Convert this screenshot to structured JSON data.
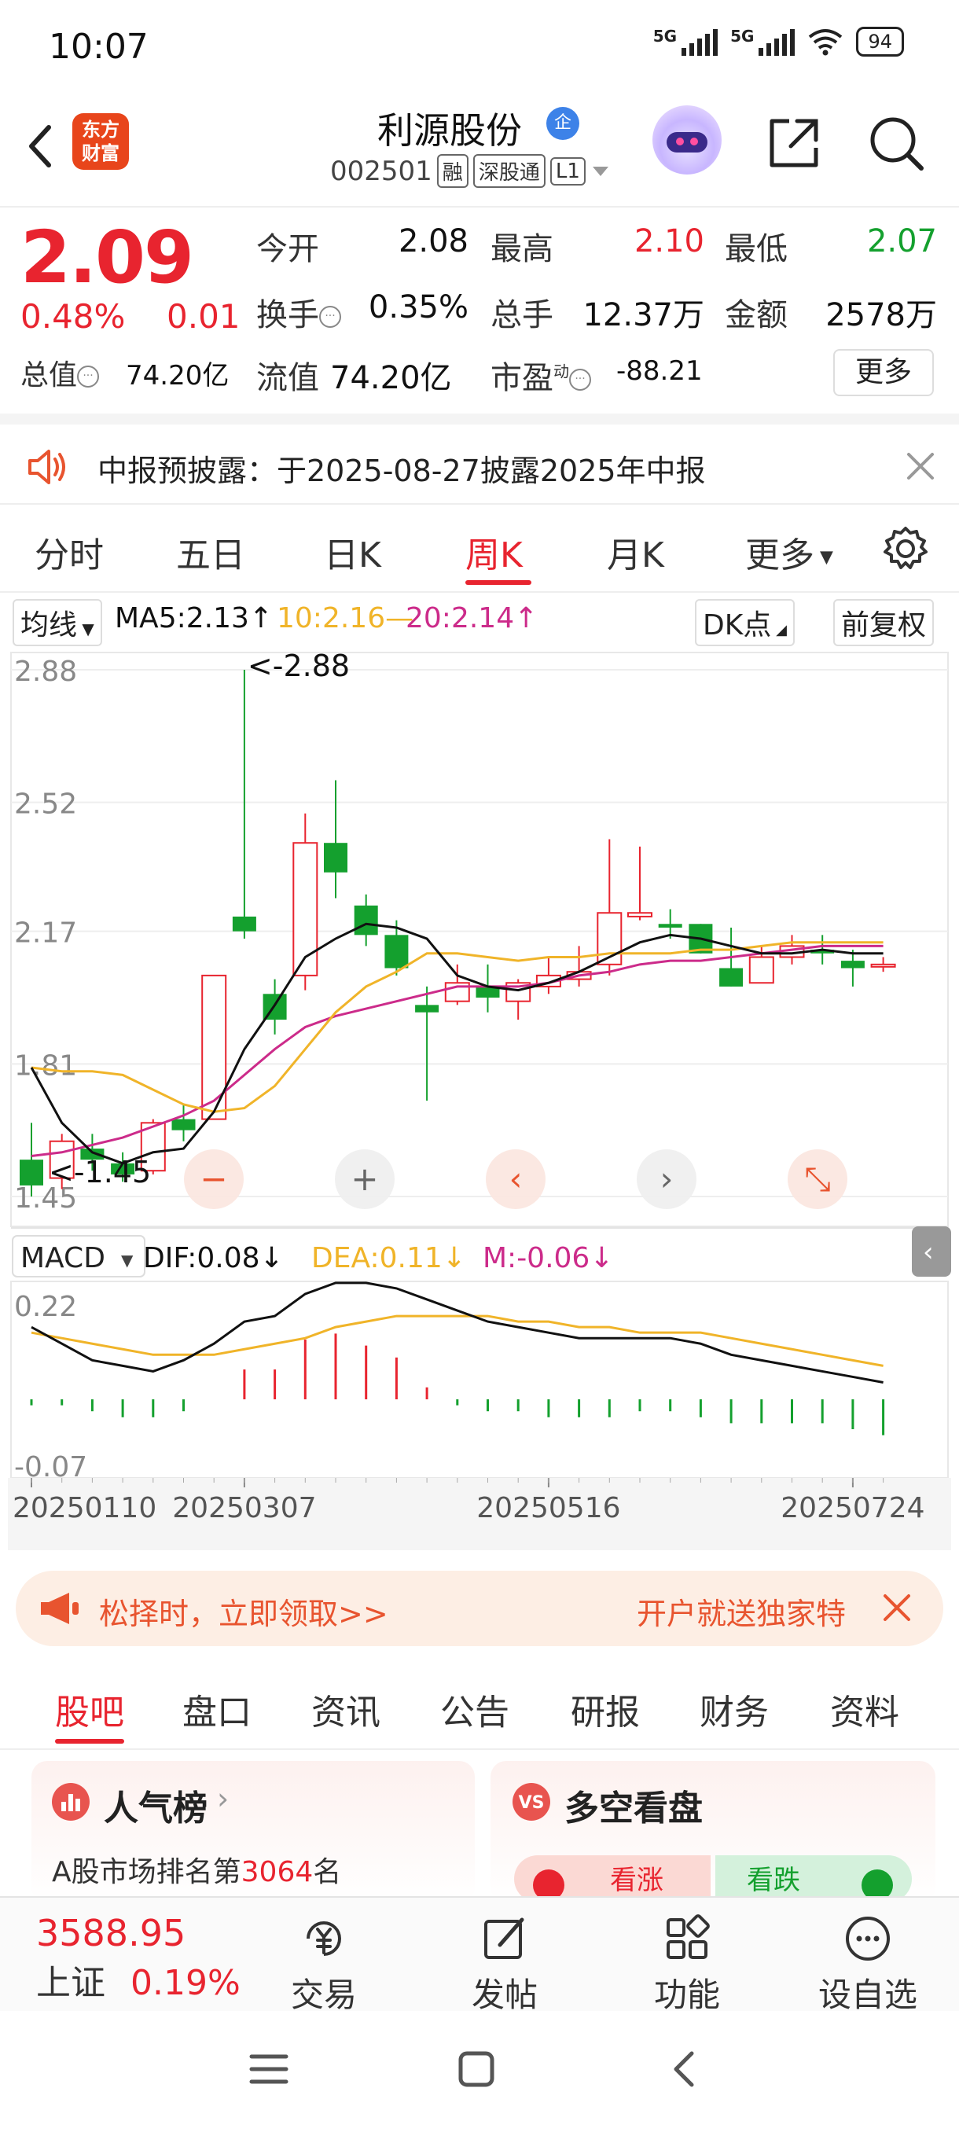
{
  "status_bar": {
    "time": "10:07",
    "network_1": "5G",
    "network_2": "5G",
    "battery": "94"
  },
  "header": {
    "logo_line1": "东方",
    "logo_line2": "财富",
    "stock_name": "利源股份",
    "badge": "企",
    "stock_code": "002501",
    "tags": [
      "融",
      "深股通",
      "L1"
    ]
  },
  "quote": {
    "price": "2.09",
    "change_pct": "0.48%",
    "change_amt": "0.01",
    "open_label": "今开",
    "open": "2.08",
    "high_label": "最高",
    "high": "2.10",
    "low_label": "最低",
    "low": "2.07",
    "turnover_label": "换手",
    "turnover": "0.35%",
    "volume_label": "总手",
    "volume": "12.37万",
    "amount_label": "金额",
    "amount": "2578万",
    "mktcap_label": "总值",
    "mktcap": "74.20亿",
    "float_label": "流值",
    "float": "74.20亿",
    "pe_label": "市盈",
    "pe_sup": "动",
    "pe": "-88.21",
    "more": "更多"
  },
  "notice": {
    "text": "中报预披露：于2025-08-27披露2025年中报"
  },
  "chart_tabs": [
    "分时",
    "五日",
    "日K",
    "周K",
    "月K",
    "更多"
  ],
  "chart_tabs_active": 3,
  "indicator": {
    "ma_select": "均线",
    "ma5": "MA5:2.13",
    "ma10": "10:2.16",
    "ma20": "20:2.14",
    "dk": "DK点",
    "adj": "前复权"
  },
  "macd": {
    "select": "MACD",
    "dif": "DIF:0.08",
    "dea": "DEA:0.11",
    "m": "M:-0.06"
  },
  "colors": {
    "up": "#e8242f",
    "down": "#14a02e",
    "ma5": "#111111",
    "ma10": "#f0b429",
    "ma20": "#cc2b8a"
  },
  "chart_data": {
    "type": "candlestick",
    "y_ticks": [
      "2.88",
      "2.52",
      "2.17",
      "1.81",
      "1.45"
    ],
    "ylim": [
      1.45,
      2.88
    ],
    "max_label": "<-2.88",
    "min_label": "<-1.45",
    "x_labels": [
      "20250110",
      "20250307",
      "20250516",
      "20250724"
    ],
    "candles": [
      {
        "o": 1.55,
        "c": 1.48,
        "h": 1.65,
        "l": 1.45
      },
      {
        "o": 1.5,
        "c": 1.6,
        "h": 1.62,
        "l": 1.47
      },
      {
        "o": 1.58,
        "c": 1.55,
        "h": 1.62,
        "l": 1.52
      },
      {
        "o": 1.54,
        "c": 1.51,
        "h": 1.57,
        "l": 1.49
      },
      {
        "o": 1.52,
        "c": 1.65,
        "h": 1.66,
        "l": 1.51
      },
      {
        "o": 1.66,
        "c": 1.63,
        "h": 1.7,
        "l": 1.6
      },
      {
        "o": 1.66,
        "c": 2.05,
        "h": 2.05,
        "l": 1.66
      },
      {
        "o": 2.21,
        "c": 2.17,
        "h": 2.88,
        "l": 2.15
      },
      {
        "o": 2.0,
        "c": 1.93,
        "h": 2.04,
        "l": 1.89
      },
      {
        "o": 2.05,
        "c": 2.41,
        "h": 2.49,
        "l": 2.01
      },
      {
        "o": 2.41,
        "c": 2.33,
        "h": 2.58,
        "l": 2.26
      },
      {
        "o": 2.24,
        "c": 2.16,
        "h": 2.27,
        "l": 2.13
      },
      {
        "o": 2.16,
        "c": 2.07,
        "h": 2.2,
        "l": 2.05
      },
      {
        "o": 1.97,
        "c": 1.95,
        "h": 2.02,
        "l": 1.71
      },
      {
        "o": 1.98,
        "c": 2.03,
        "h": 2.08,
        "l": 1.97
      },
      {
        "o": 2.02,
        "c": 1.99,
        "h": 2.08,
        "l": 1.95
      },
      {
        "o": 1.98,
        "c": 2.03,
        "h": 2.04,
        "l": 1.93
      },
      {
        "o": 2.02,
        "c": 2.05,
        "h": 2.1,
        "l": 2.0
      },
      {
        "o": 2.04,
        "c": 2.06,
        "h": 2.13,
        "l": 2.02
      },
      {
        "o": 2.08,
        "c": 2.22,
        "h": 2.42,
        "l": 2.05
      },
      {
        "o": 2.21,
        "c": 2.22,
        "h": 2.4,
        "l": 2.2
      },
      {
        "o": 2.19,
        "c": 2.18,
        "h": 2.23,
        "l": 2.15
      },
      {
        "o": 2.19,
        "c": 2.11,
        "h": 2.19,
        "l": 2.11
      },
      {
        "o": 2.07,
        "c": 2.02,
        "h": 2.18,
        "l": 2.02
      },
      {
        "o": 2.03,
        "c": 2.1,
        "h": 2.13,
        "l": 2.03
      },
      {
        "o": 2.1,
        "c": 2.13,
        "h": 2.16,
        "l": 2.08
      },
      {
        "o": 2.12,
        "c": 2.11,
        "h": 2.16,
        "l": 2.08
      },
      {
        "o": 2.09,
        "c": 2.07,
        "h": 2.12,
        "l": 2.02
      },
      {
        "o": 2.08,
        "c": 2.08,
        "h": 2.1,
        "l": 2.06
      }
    ],
    "ma5": [
      1.8,
      1.65,
      1.57,
      1.54,
      1.57,
      1.58,
      1.68,
      1.85,
      1.97,
      2.1,
      2.15,
      2.19,
      2.18,
      2.15,
      2.05,
      2.02,
      2.01,
      2.03,
      2.06,
      2.1,
      2.14,
      2.16,
      2.15,
      2.13,
      2.11,
      2.11,
      2.12,
      2.11,
      2.11
    ],
    "ma10": [
      1.8,
      1.79,
      1.79,
      1.78,
      1.74,
      1.7,
      1.68,
      1.69,
      1.75,
      1.85,
      1.95,
      2.02,
      2.06,
      2.11,
      2.11,
      2.1,
      2.09,
      2.1,
      2.1,
      2.11,
      2.11,
      2.11,
      2.12,
      2.12,
      2.13,
      2.14,
      2.14,
      2.14,
      2.14
    ],
    "ma20": [
      1.56,
      1.57,
      1.59,
      1.61,
      1.64,
      1.67,
      1.71,
      1.78,
      1.85,
      1.91,
      1.94,
      1.96,
      1.98,
      2.0,
      2.02,
      2.02,
      2.02,
      2.03,
      2.05,
      2.06,
      2.08,
      2.09,
      2.09,
      2.1,
      2.11,
      2.12,
      2.13,
      2.13,
      2.13
    ],
    "macd": {
      "y_ticks": [
        "0.22",
        "-0.07"
      ],
      "ylim": [
        -0.07,
        0.22
      ],
      "dif": [
        0.18,
        0.15,
        0.12,
        0.11,
        0.1,
        0.12,
        0.15,
        0.19,
        0.2,
        0.24,
        0.26,
        0.26,
        0.25,
        0.23,
        0.21,
        0.19,
        0.18,
        0.17,
        0.16,
        0.16,
        0.16,
        0.16,
        0.15,
        0.13,
        0.12,
        0.11,
        0.1,
        0.09,
        0.08
      ],
      "dea": [
        0.17,
        0.16,
        0.15,
        0.14,
        0.13,
        0.13,
        0.13,
        0.14,
        0.15,
        0.16,
        0.18,
        0.19,
        0.2,
        0.2,
        0.2,
        0.2,
        0.19,
        0.19,
        0.18,
        0.18,
        0.17,
        0.17,
        0.17,
        0.16,
        0.15,
        0.14,
        0.13,
        0.12,
        0.11
      ],
      "hist": [
        -0.01,
        -0.01,
        -0.02,
        -0.03,
        -0.03,
        -0.02,
        0.0,
        0.05,
        0.05,
        0.1,
        0.11,
        0.09,
        0.07,
        0.02,
        -0.01,
        -0.02,
        -0.02,
        -0.03,
        -0.03,
        -0.03,
        -0.02,
        -0.02,
        -0.03,
        -0.04,
        -0.04,
        -0.04,
        -0.04,
        -0.05,
        -0.06
      ]
    }
  },
  "ad": {
    "left": "松择时，立即领取>>",
    "right": "开户就送独家特"
  },
  "sub_tabs": [
    "股吧",
    "盘口",
    "资讯",
    "公告",
    "研报",
    "财务",
    "资料"
  ],
  "sub_tabs_active": 0,
  "cards": {
    "popularity_title": "人气榜",
    "popularity_rank_prefix": "A股市场排名第",
    "popularity_rank": "3064",
    "popularity_rank_suffix": "名",
    "bull_bear_title": "多空看盘",
    "bull": "看涨",
    "bear": "看跌"
  },
  "bottom_bar": {
    "index_value": "3588.95",
    "index_name": "上证",
    "index_change": "0.19%",
    "trade": "交易",
    "post": "发帖",
    "features": "功能",
    "watchlist": "设自选"
  }
}
